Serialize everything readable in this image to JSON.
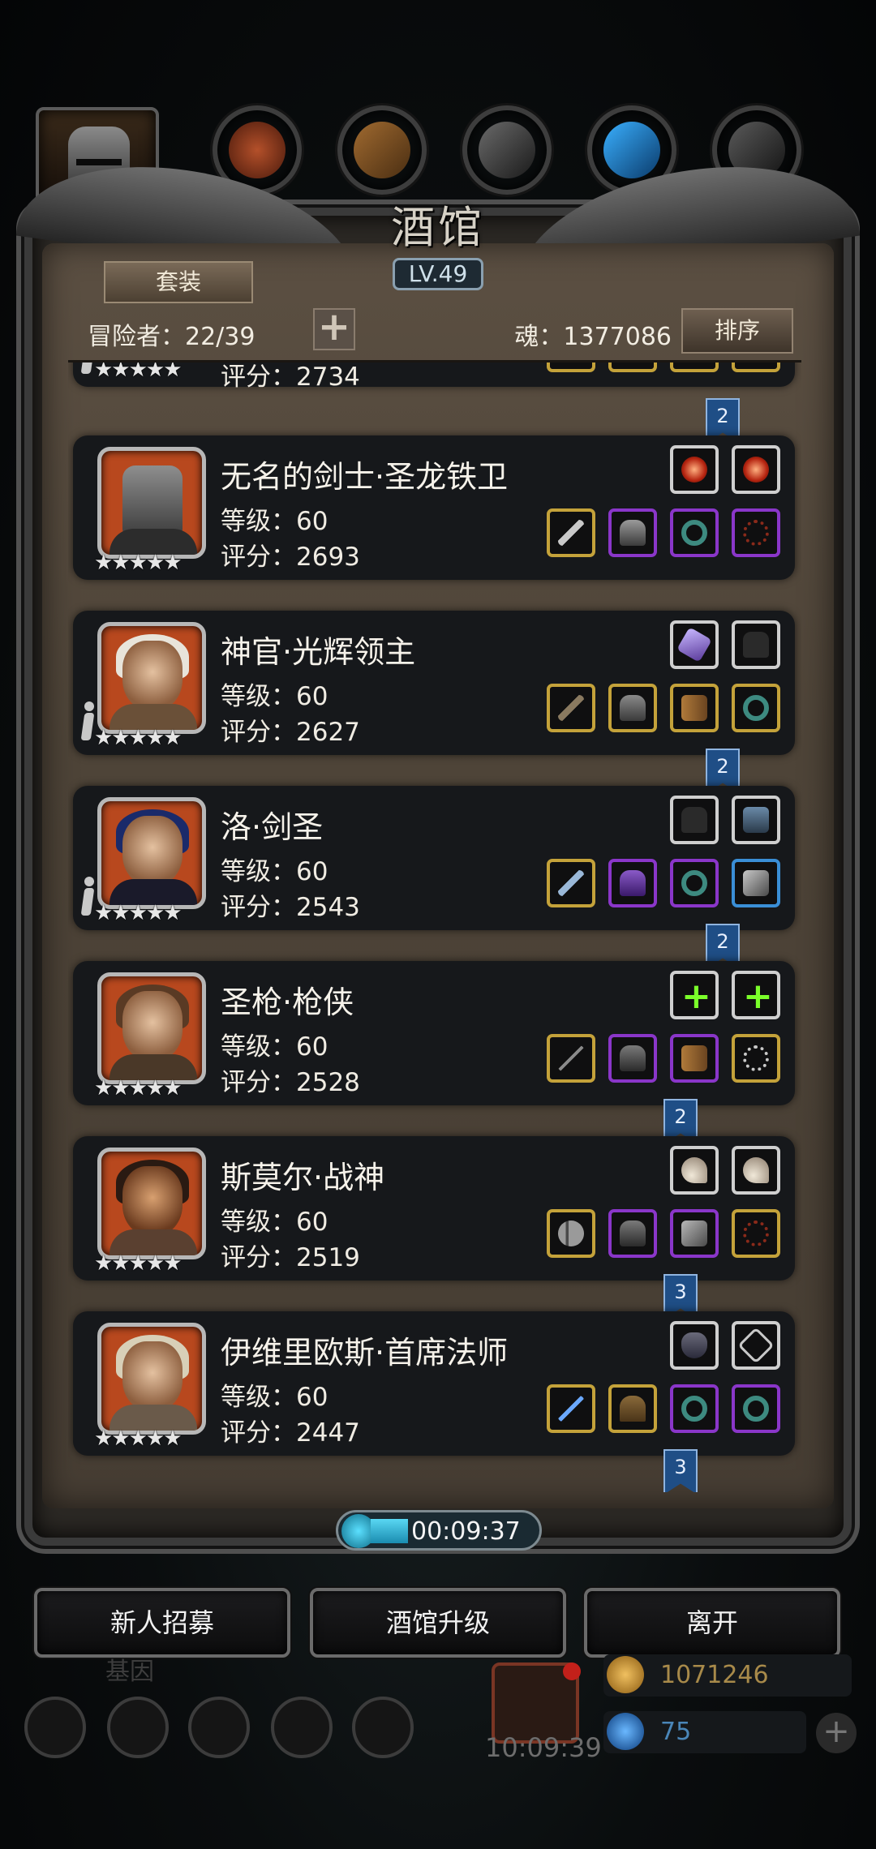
{
  "window": {
    "title": "酒馆",
    "level": "LV.49"
  },
  "controls": {
    "set_label": "套装",
    "sort_label": "排序"
  },
  "stats": {
    "adventurers": "冒险者：22/39",
    "soul": "魂：1377086"
  },
  "partial_row": {
    "stars": "★★★★★",
    "score": "评分：2734"
  },
  "heroes": [
    {
      "name": "无名的剑士·圣龙铁卫",
      "level": "等级：60",
      "score": "评分：2693",
      "stars": "★★★★★",
      "tier": "",
      "deployed": false,
      "top_slots": [
        "fire-gem",
        "fire-gem"
      ],
      "slots": [
        "sword",
        "chest-armor",
        "ring",
        "necklace"
      ]
    },
    {
      "name": "神官·光辉领主",
      "level": "等级：60",
      "score": "评分：2627",
      "stars": "★★★★★",
      "tier": "2",
      "deployed": true,
      "top_slots": [
        "crystal",
        "glove"
      ],
      "slots": [
        "mace",
        "chest-armor",
        "bracer",
        "ring"
      ]
    },
    {
      "name": "洛·剑圣",
      "level": "等级：60",
      "score": "评分：2543",
      "stars": "★★★★★",
      "tier": "2",
      "deployed": true,
      "top_slots": [
        "glove",
        "book"
      ],
      "slots": [
        "sword",
        "chest-armor",
        "ring",
        "gauntlet"
      ]
    },
    {
      "name": "圣枪·枪侠",
      "level": "等级：60",
      "score": "评分：2528",
      "stars": "★★★★★",
      "tier": "2",
      "deployed": false,
      "top_slots": [
        "add",
        "add"
      ],
      "slots": [
        "spear",
        "chest-armor",
        "bracer",
        "necklace"
      ]
    },
    {
      "name": "斯莫尔·战神",
      "level": "等级：60",
      "score": "评分：2519",
      "stars": "★★★★★",
      "tier": "3",
      "deployed": false,
      "top_slots": [
        "claw",
        "claw"
      ],
      "slots": [
        "axe",
        "chest-armor",
        "gauntlet",
        "necklace"
      ]
    },
    {
      "name": "伊维里欧斯·首席法师",
      "level": "等级：60",
      "score": "评分：2447",
      "stars": "★★★★★",
      "tier": "3",
      "deployed": false,
      "top_slots": [
        "mask",
        "sigil"
      ],
      "slots": [
        "staff",
        "robe",
        "ring",
        "ring"
      ]
    }
  ],
  "final_tier": "3",
  "timer": "00:09:37",
  "buttons": {
    "recruit": "新人招募",
    "upgrade": "酒馆升级",
    "leave": "离开"
  },
  "hud": {
    "label": "基因",
    "time": "10:09:39",
    "gold": "1071246",
    "gems": "75"
  },
  "colors": {
    "gold": "#c4a23a",
    "purple": "#8a36c9",
    "white": "#cfcfcf",
    "blue": "#3a8ed6",
    "portrait_bg": "#b8481e",
    "tier_flag": "#1f4e86"
  }
}
